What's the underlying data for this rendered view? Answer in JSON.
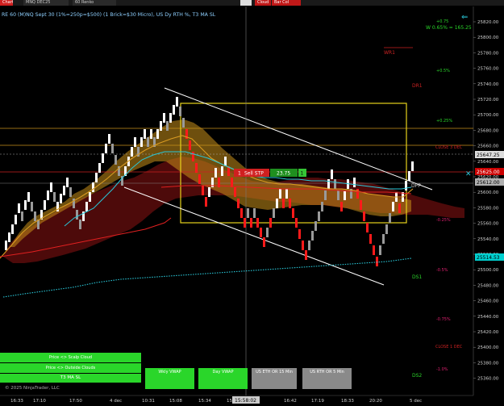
{
  "topbar": {
    "chart_tab": "Chart",
    "instrument": "MNQ DEC25",
    "bar_type": "60 Renko",
    "indicator_a": "",
    "indicator_b": "Cloud",
    "indicator_c": "Bar Col"
  },
  "chart_title": "RE 60 (M)NQ Sept 30 (1%=250p=$500) (1 Brick=$30 Micro), US Dy RTH %, T3 MA SL",
  "copyright": "© 2025 NinjaTrader, LLC",
  "stat_line": "W 0.65% = 165.25",
  "price_axis": {
    "ticks": [
      "25820.00",
      "25800.00",
      "25780.00",
      "25760.00",
      "25740.00",
      "25720.00",
      "25700.00",
      "25680.00",
      "25660.00",
      "25640.00",
      "25620.00",
      "25600.00",
      "25580.00",
      "25560.00",
      "25540.00",
      "25520.00",
      "25500.00",
      "25480.00",
      "25460.00",
      "25440.00",
      "25420.00",
      "25400.00",
      "25380.00",
      "25360.00"
    ],
    "labels": [
      {
        "text": "25647.25",
        "color": "#dddddd",
        "text_color": "#000000"
      },
      {
        "text": "25625.00",
        "color": "#cc0000",
        "text_color": "#ffffff"
      },
      {
        "text": "25612.00",
        "color": "#b0b0b0",
        "text_color": "#000000"
      },
      {
        "text": "25514.53",
        "color": "#00d0d0",
        "text_color": "#000000"
      }
    ]
  },
  "time_axis": {
    "ticks": [
      "16:33",
      "17:10",
      "17:50",
      "4 dec",
      "10:31",
      "15:08",
      "15:34",
      "15:42",
      "16:42",
      "17:19",
      "18:33",
      "20:20",
      "5 dec"
    ],
    "cursor_time": "15:58:02"
  },
  "levels": {
    "wr1": "WR1",
    "dr1": "DR1",
    "close_3dec": "CLOSE 3 DEC",
    "dpp": "DPP",
    "ds1": "DS1",
    "ds2": "DS2",
    "close_1dec": "CLOSE 1 DEC"
  },
  "pct_labels": [
    "+0.75",
    "+0.5%",
    "+0.25%",
    "-0.25%",
    "-0.5%",
    "-0.75%",
    "-1.0%"
  ],
  "order": {
    "qty": "1",
    "label": "Sell STP",
    "price": "23.75",
    "count": "1"
  },
  "buttons": {
    "scalp_cloud": "Price <> Scalp Cloud",
    "outside_clouds": "Price <> Outside Clouds",
    "t3_ma_sl": "T3 MA SL",
    "wkly_vwap": "Wkly VWAP",
    "day_vwap": "Day VWAP",
    "eth_or": "US ETH OR 15 Min",
    "rth_or": "US RTH OR 5 Min"
  },
  "colors": {
    "background": "#000000",
    "brick_up": "#ffffff",
    "brick_down": "#ff1a1a",
    "brick_neutral": "#9a9a9a",
    "cloud_gold": "#c8901a",
    "cloud_red": "#5a0c0c",
    "vwap_cyan": "#29c7d8",
    "box_yellow": "#e6d31c"
  }
}
